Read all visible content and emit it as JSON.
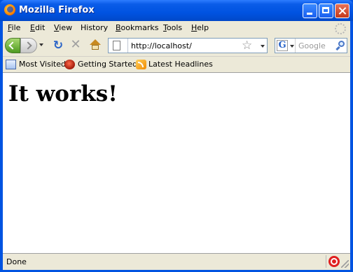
{
  "window": {
    "title": "Mozilla Firefox"
  },
  "menubar": {
    "items": [
      {
        "key": "F",
        "rest": "ile"
      },
      {
        "key": "E",
        "rest": "dit"
      },
      {
        "key": "V",
        "rest": "iew"
      },
      {
        "key": "",
        "rest": "History"
      },
      {
        "key": "B",
        "rest": "ookmarks"
      },
      {
        "key": "T",
        "rest": "ools"
      },
      {
        "key": "H",
        "rest": "elp"
      }
    ]
  },
  "navigation": {
    "url": "http://localhost/",
    "search_engine_glyph": "G",
    "search_placeholder": "Google"
  },
  "bookmarks": {
    "items": [
      {
        "label": "Most Visited",
        "icon": "most-visited-icon"
      },
      {
        "label": "Getting Started",
        "icon": "firefox-icon"
      },
      {
        "label": "Latest Headlines",
        "icon": "rss-feed-icon"
      }
    ]
  },
  "content": {
    "heading": "It works!"
  },
  "status": {
    "text": "Done"
  },
  "colors": {
    "titlebar": "#0053e1",
    "chrome": "#ece9d8",
    "close_button": "#c4381a"
  }
}
